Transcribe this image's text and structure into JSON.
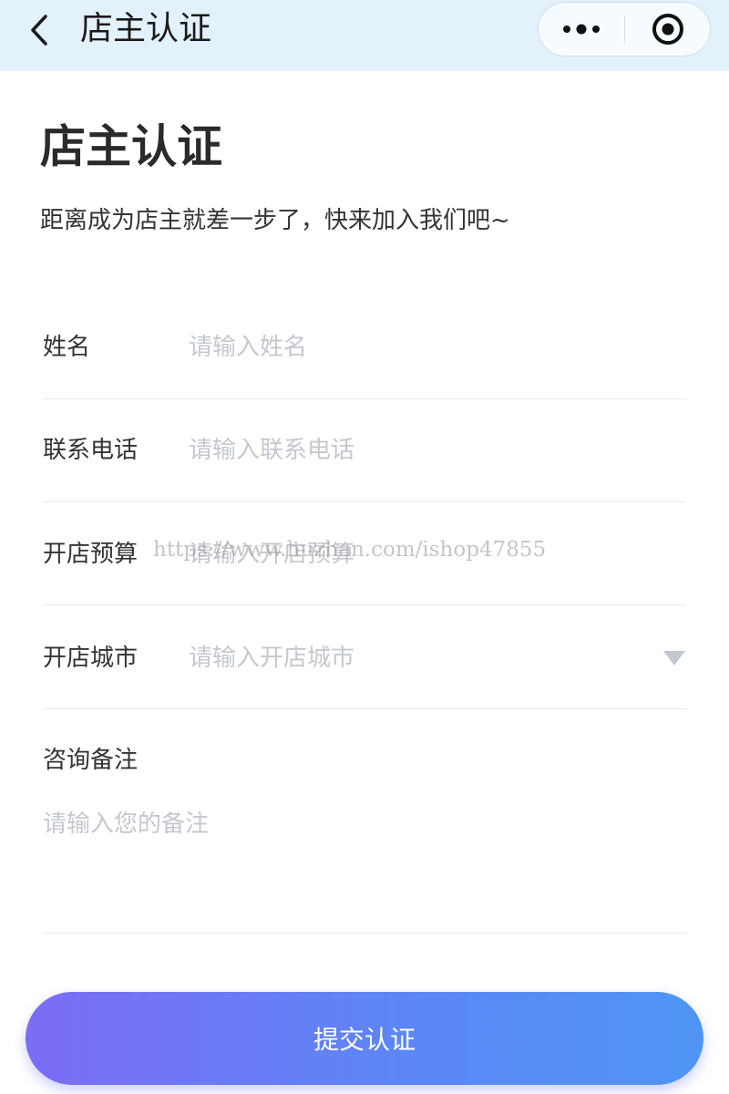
{
  "nav": {
    "title": "店主认证"
  },
  "header": {
    "title": "店主认证",
    "subtitle": "距离成为店主就差一步了，快来加入我们吧~"
  },
  "form": {
    "name": {
      "label": "姓名",
      "placeholder": "请输入姓名",
      "value": ""
    },
    "phone": {
      "label": "联系电话",
      "placeholder": "请输入联系电话",
      "value": ""
    },
    "budget": {
      "label": "开店预算",
      "placeholder": "请输入开店预算",
      "value": ""
    },
    "city": {
      "label": "开店城市",
      "placeholder": "请输入开店城市",
      "value": ""
    },
    "remark": {
      "label": "咨询备注",
      "placeholder": "请输入您的备注",
      "value": ""
    }
  },
  "watermark": "https://www.huzhan.com/ishop47855",
  "submit": {
    "label": "提交认证"
  },
  "icons": {
    "back": "chevron-left-icon",
    "more": "more-dots-icon",
    "close": "target-circle-icon",
    "dropdown": "triangle-down-icon"
  },
  "colors": {
    "topbar": "#e3f1fb",
    "button_gradient_start": "#7c6cf6",
    "button_gradient_end": "#4f95f4",
    "placeholder": "#c4c8cf",
    "divider": "#e8e8ec"
  }
}
